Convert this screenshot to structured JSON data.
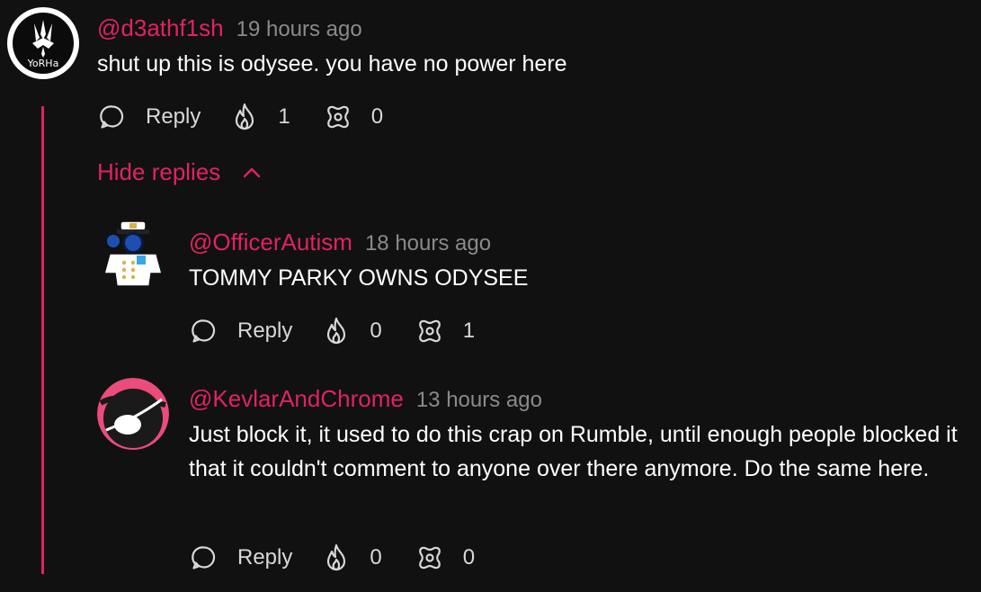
{
  "comments": [
    {
      "handle": "@d3athf1sh",
      "time": "19 hours ago",
      "text": "shut up this is odysee. you have no power here",
      "avatar_label": "YoRHa",
      "reply_label": "Reply",
      "fire_count": "1",
      "slime_count": "0"
    },
    {
      "handle": "@OfficerAutism",
      "time": "18 hours ago",
      "text": "TOMMY PARKY OWNS ODYSEE",
      "reply_label": "Reply",
      "fire_count": "0",
      "slime_count": "1"
    },
    {
      "handle": "@KevlarAndChrome",
      "time": "13 hours ago",
      "text": "Just block it, it used to do this crap on Rumble, until enough people blocked it that it couldn't comment to anyone over there anymore. Do the same here.",
      "reply_label": "Reply",
      "fire_count": "0",
      "slime_count": "0"
    }
  ],
  "hide_replies_label": "Hide replies",
  "colors": {
    "accent": "#e0245e",
    "background": "#111112",
    "muted": "#8a8a8a"
  },
  "icons": {
    "reply": "speech-bubble-icon",
    "fire": "fire-icon",
    "slime": "slime-icon",
    "hide": "chevron-up-icon"
  }
}
